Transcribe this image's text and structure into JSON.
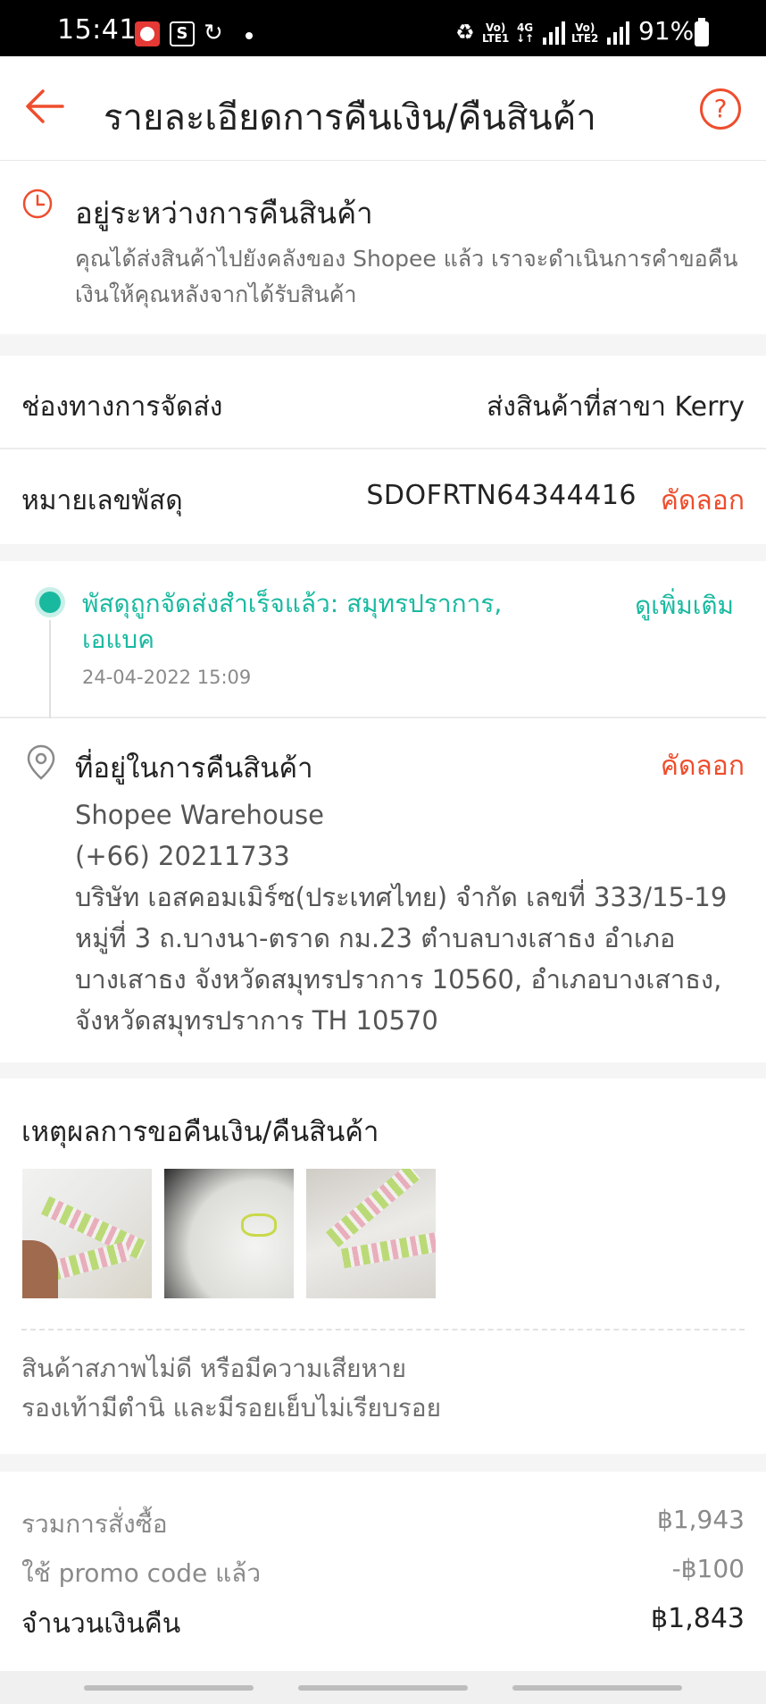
{
  "status_bar": {
    "time": "15:41",
    "battery": "91%",
    "net1": "Vo)\nLTE1",
    "net2": "4G",
    "net3": "Vo)\nLTE2",
    "icons": [
      "app-notification-icon",
      "shopee-icon",
      "sync-icon",
      "recycle-icon",
      "signal-icon",
      "battery-icon"
    ]
  },
  "header": {
    "title": "รายละเอียดการคืนเงิน/คืนสินค้า",
    "back_icon": "arrow-left-icon",
    "help_label": "?"
  },
  "status": {
    "title": "อยู่ระหว่างการคืนสินค้า",
    "description": "คุณได้ส่งสินค้าไปยังคลังของ Shopee แล้ว เราจะดำเนินการคำขอคืนเงินให้คุณหลังจากได้รับสินค้า"
  },
  "shipping": {
    "channel_label": "ช่องทางการจัดส่ง",
    "channel_value": "ส่งสินค้าที่สาขา Kerry",
    "tracking_label": "หมายเลขพัสดุ",
    "tracking_number": "SDOFRTN64344416",
    "copy_label": "คัดลอก"
  },
  "tracking": {
    "status_text": "พัสดุถูกจัดส่งสำเร็จแล้ว: สมุทรปราการ, เอแบค",
    "timestamp": "24-04-2022 15:09",
    "more_label": "ดูเพิ่มเติม"
  },
  "address": {
    "title": "ที่อยู่ในการคืนสินค้า",
    "copy_label": "คัดลอก",
    "name": "Shopee Warehouse",
    "phone": "(+66) 20211733",
    "detail": "บริษัท เอสคอมเมิร์ซ(ประเทศไทย) จำกัด เลขที่ 333/15-19 หมู่ที่ 3 ถ.บางนา-ตราด กม.23 ตำบลบางเสาธง อำเภอบางเสาธง จังหวัดสมุทรปราการ 10560, อำเภอบางเสาธง, จังหวัดสมุทรปราการ TH 10570"
  },
  "reason": {
    "title": "เหตุผลการขอคืนเงิน/คืนสินค้า",
    "line1": "สินค้าสภาพไม่ดี หรือมีความเสียหาย",
    "line2": "รองเท้ามีตำนิ และมีรอยเย็บไม่เรียบรอย"
  },
  "summary": {
    "order_total_label": "รวมการสั่งซื้อ",
    "order_total_value": "฿1,943",
    "promo_label": "ใช้ promo code แล้ว",
    "promo_value": "-฿100",
    "refund_label": "จำนวนเงินคืน",
    "refund_value": "฿1,843"
  },
  "colors": {
    "accent": "#ee4d2d",
    "teal": "#19b9a0",
    "background": "#f5f5f5"
  }
}
